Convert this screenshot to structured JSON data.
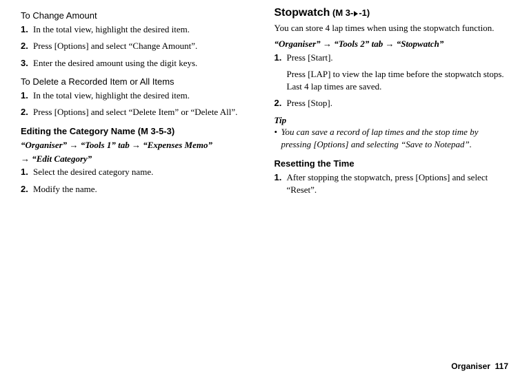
{
  "left": {
    "h1_title": "To Change Amount",
    "h1_steps": [
      "In the total view, highlight the desired item.",
      "Press [Options] and select “Change Amount”.",
      "Enter the desired amount using the digit keys."
    ],
    "h2_title": "To Delete a Recorded Item or All Items",
    "h2_steps": [
      "In the total view, highlight the desired item.",
      "Press [Options] and select “Delete Item” or “Delete All”."
    ],
    "h3_title": "Editing the Category Name",
    "h3_code_prefix": " (M 3-5-3)",
    "h3_path_1a": "“Organiser”",
    "h3_path_1b": "“Tools 1” tab",
    "h3_path_1c": "“Expenses Memo”",
    "h3_path_2": "“Edit Category”",
    "h3_steps": [
      "Select the desired category name.",
      "Modify the name."
    ]
  },
  "right": {
    "title": "Stopwatch",
    "title_code_a": " (M 3-",
    "title_code_b": "-1)",
    "intro": "You can store 4 lap times when using the stopwatch function.",
    "path_a": "“Organiser”",
    "path_b": "“Tools 2” tab",
    "path_c": "“Stopwatch”",
    "step1": "Press [Start].",
    "step1_extra": "Press [LAP] to view the lap time before the stopwatch stops. Last 4 lap times are saved.",
    "step2": "Press [Stop].",
    "tip_label": "Tip",
    "tip_body": "You can save a record of lap times and the stop time by pressing [Options] and selecting “Save to Notepad”.",
    "reset_title": "Resetting the Time",
    "reset_step": "After stopping the stopwatch, press [Options] and select “Reset”."
  },
  "footer": {
    "section": "Organiser",
    "page": "117"
  },
  "glyph": {
    "arrow": "→",
    "bullet": "•"
  }
}
